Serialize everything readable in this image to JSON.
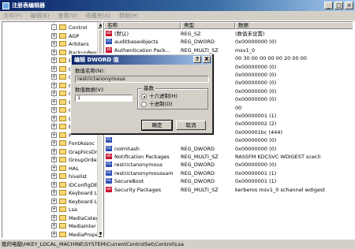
{
  "window": {
    "title": "注册表编辑器"
  },
  "menu": [
    {
      "label": "文件(F)",
      "enabled": false
    },
    {
      "label": "编辑(E)",
      "enabled": false
    },
    {
      "label": "查看(V)",
      "enabled": false
    },
    {
      "label": "收藏夹(A)",
      "enabled": false
    },
    {
      "label": "帮助(H)",
      "enabled": false
    }
  ],
  "tree": [
    {
      "label": "Control",
      "expanded": true
    },
    {
      "label": "AGP",
      "expanded": false
    },
    {
      "label": "Arbiters",
      "expanded": false
    },
    {
      "label": "BackupRest",
      "expanded": false
    },
    {
      "label": "B",
      "expanded": false
    },
    {
      "label": "C",
      "expanded": false
    },
    {
      "label": "C",
      "expanded": false
    },
    {
      "label": "C",
      "expanded": false
    },
    {
      "label": "C",
      "expanded": false
    },
    {
      "label": "C",
      "expanded": false
    },
    {
      "label": "C",
      "expanded": false
    },
    {
      "label": "D",
      "expanded": false
    },
    {
      "label": "E",
      "expanded": false
    },
    {
      "label": "F",
      "expanded": false
    },
    {
      "label": "FontAssoc",
      "expanded": false
    },
    {
      "label": "GraphicsDr",
      "expanded": false
    },
    {
      "label": "GroupOrder",
      "expanded": false
    },
    {
      "label": "HAL",
      "expanded": false
    },
    {
      "label": "hivelist",
      "expanded": false
    },
    {
      "label": "IDConfigDE",
      "expanded": false
    },
    {
      "label": "Keyboard L",
      "expanded": false
    },
    {
      "label": "Keyboard L",
      "expanded": false
    },
    {
      "label": "Lsa",
      "expanded": false
    },
    {
      "label": "MediaCateg",
      "expanded": false
    },
    {
      "label": "MediaInter",
      "expanded": false
    },
    {
      "label": "MediaPrope",
      "expanded": false
    }
  ],
  "list": {
    "headers": [
      "名称",
      "类型",
      "数据"
    ],
    "rows": [
      {
        "icon": "string",
        "name": "(默认)",
        "type": "REG_SZ",
        "data": "(数值未设置)"
      },
      {
        "icon": "binary",
        "name": "auditbaseobjects",
        "type": "REG_DWORD",
        "data": "0x00000000 (0)"
      },
      {
        "icon": "string",
        "name": "Authentication Pack...",
        "type": "REG_MULTI_SZ",
        "data": "msv1_0"
      },
      {
        "icon": "binary",
        "name": "",
        "type": "",
        "data": "00 30 00 00 00 00 20 00 00"
      },
      {
        "icon": "binary",
        "name": "",
        "type": "",
        "data": "0x00000000 (0)"
      },
      {
        "icon": "binary",
        "name": "",
        "type": "",
        "data": "0x00000000 (0)"
      },
      {
        "icon": "binary",
        "name": "",
        "type": "",
        "data": "0x00000000 (0)"
      },
      {
        "icon": "binary",
        "name": "",
        "type": "",
        "data": "0x00000000 (0)"
      },
      {
        "icon": "binary",
        "name": "",
        "type": "",
        "data": "0x00000000 (0)"
      },
      {
        "icon": "binary",
        "name": "",
        "type": "",
        "data": "00"
      },
      {
        "icon": "binary",
        "name": "",
        "type": "",
        "data": "0x00000001 (1)"
      },
      {
        "icon": "binary",
        "name": "",
        "type": "",
        "data": "0x00000002 (2)"
      },
      {
        "icon": "binary",
        "name": "",
        "type": "",
        "data": "0x000001bc (444)"
      },
      {
        "icon": "binary",
        "name": "",
        "type": "",
        "data": "0x00000000 (0)"
      },
      {
        "icon": "binary",
        "name": "nolmhash",
        "type": "REG_DWORD",
        "data": "0x00000000 (0)"
      },
      {
        "icon": "string",
        "name": "Notification Packages",
        "type": "REG_MULTI_SZ",
        "data": "RASSFM KDCSVC WDIGEST scecli"
      },
      {
        "icon": "binary",
        "name": "restrictanonymous",
        "type": "REG_DWORD",
        "data": "0x00000000 (0)"
      },
      {
        "icon": "binary",
        "name": "restrictanonymoussam",
        "type": "REG_DWORD",
        "data": "0x00000001 (1)"
      },
      {
        "icon": "binary",
        "name": "SecureBoot",
        "type": "REG_DWORD",
        "data": "0x00000001 (1)"
      },
      {
        "icon": "string",
        "name": "Security Packages",
        "type": "REG_MULTI_SZ",
        "data": "kerberos msv1_0 schannel wdigest"
      }
    ]
  },
  "statusbar": {
    "path": "我的电脑\\HKEY_LOCAL_MACHINE\\SYSTEM\\CurrentControlSet\\Control\\Lsa"
  },
  "dialog": {
    "title": "编辑 DWORD 值",
    "help_button": "?",
    "close_button": "X",
    "name_label": "数值名称(N):",
    "name_value": "restrictanonymous",
    "data_label": "数值数据(V):",
    "data_value": "1",
    "base_label": "基数",
    "radio_hex": "十六进制(H)",
    "radio_dec": "十进制(D)",
    "base_selected": "hex",
    "ok_button": "确定",
    "cancel_button": "取消"
  },
  "colors": {
    "titlebar": "#0a246a",
    "face": "#d4d0c8",
    "string_icon": "#c8102e",
    "binary_icon": "#2b4fb3"
  }
}
